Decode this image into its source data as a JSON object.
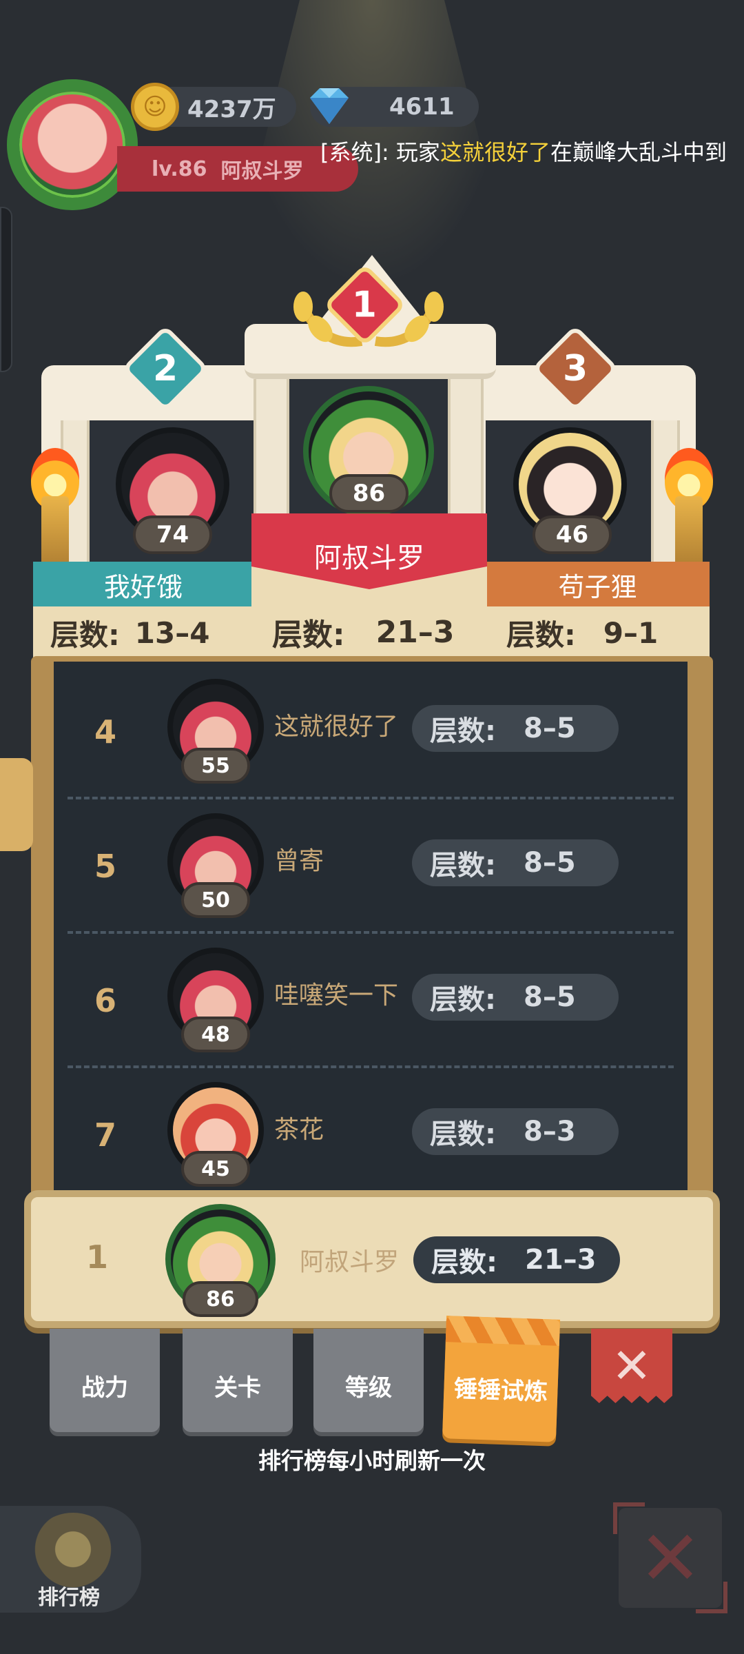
{
  "header": {
    "coins": "4237万",
    "gems": "4611",
    "player_level": "lv.86",
    "player_name": "阿叔斗罗",
    "ticker_prefix": "[系统]: 玩家",
    "ticker_player": "这就很好了",
    "ticker_suffix": "在巅峰大乱斗中到"
  },
  "podium": {
    "first": {
      "rank": "1",
      "name": "阿叔斗罗",
      "level": "86",
      "floor_label": "层数:",
      "floor": "21–3"
    },
    "second": {
      "rank": "2",
      "name": "我好饿",
      "level": "74",
      "floor_label": "层数:",
      "floor": "13–4"
    },
    "third": {
      "rank": "3",
      "name": "苟子狸",
      "level": "46",
      "floor_label": "层数:",
      "floor": "9–1"
    }
  },
  "list": [
    {
      "rank": "4",
      "name": "这就很好了",
      "level": "55",
      "floor_label": "层数:",
      "floor": "8–5"
    },
    {
      "rank": "5",
      "name": "曾寄",
      "level": "50",
      "floor_label": "层数:",
      "floor": "8–5"
    },
    {
      "rank": "6",
      "name": "哇噻笑一下",
      "level": "48",
      "floor_label": "层数:",
      "floor": "8–5"
    },
    {
      "rank": "7",
      "name": "茶花",
      "level": "45",
      "floor_label": "层数:",
      "floor": "8–3"
    }
  ],
  "my_rank": {
    "rank": "1",
    "name": "阿叔斗罗",
    "level": "86",
    "floor_label": "层数:",
    "floor": "21–3"
  },
  "tabs": [
    "战力",
    "关卡",
    "等级",
    "锤锤试炼"
  ],
  "active_tab": "锤锤试炼",
  "refresh_note": "排行榜每小时刷新一次",
  "bottom": {
    "rank_button_label": "排行榜"
  },
  "colors": {
    "accent_orange": "#f3a43c",
    "second_teal": "#3aa3a6",
    "third_orange": "#d47a3e",
    "first_red": "#d9394a"
  }
}
